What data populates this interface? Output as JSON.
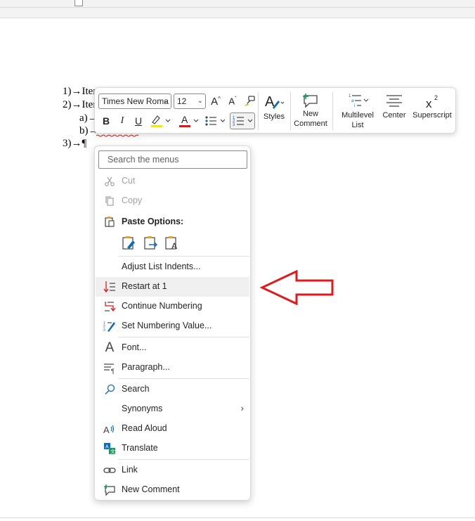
{
  "document": {
    "lines": [
      {
        "text": "1)→Iter"
      },
      {
        "text": "2)→Iter"
      },
      {
        "text": "a)→"
      },
      {
        "text": "b)→"
      },
      {
        "text": "3)→¶"
      }
    ]
  },
  "mini_toolbar": {
    "font_name": "Times New Roma",
    "font_size": "12",
    "styles_label": "Styles",
    "new_comment_label_1": "New",
    "new_comment_label_2": "Comment",
    "multilevel_label_1": "Multilevel",
    "multilevel_label_2": "List",
    "center_label": "Center",
    "superscript_label": "Superscript",
    "bold": "B",
    "italic": "I",
    "underline": "U",
    "highlight_color": "#f6e600",
    "font_color": "#e0191b"
  },
  "context_menu": {
    "search_placeholder": "Search the menus",
    "cut": "Cut",
    "copy": "Copy",
    "paste_options": "Paste Options:",
    "adjust_list_indents": "Adjust List Indents...",
    "restart_at_1": "Restart at 1",
    "continue_numbering": "Continue Numbering",
    "set_numbering_value": "Set Numbering Value...",
    "font": "Font...",
    "paragraph": "Paragraph...",
    "search": "Search",
    "synonyms": "Synonyms",
    "read_aloud": "Read Aloud",
    "translate": "Translate",
    "link": "Link",
    "new_comment": "New Comment"
  },
  "annotation": {
    "arrow_color": "#e0191b",
    "points_to": "restart_at_1"
  }
}
